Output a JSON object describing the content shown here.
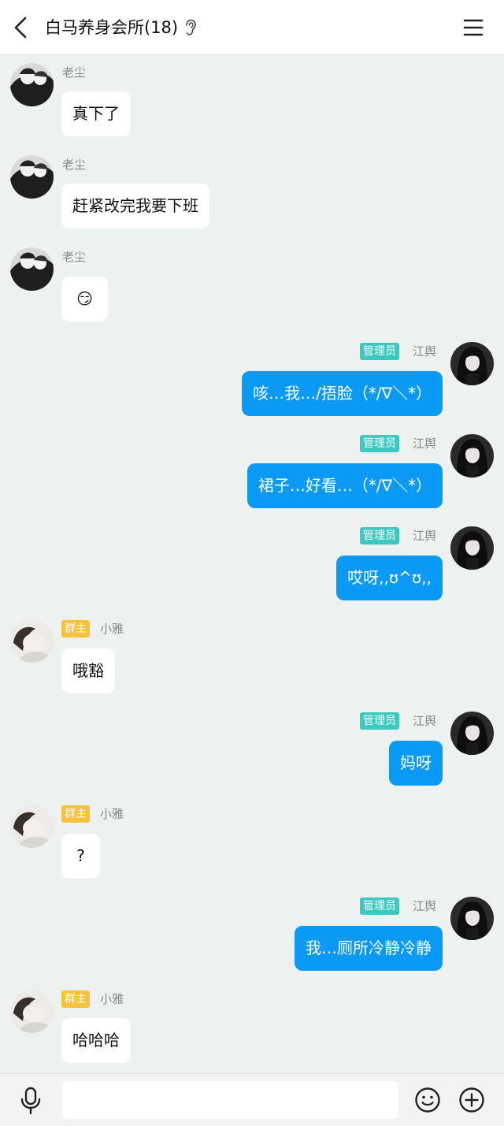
{
  "header": {
    "title": "白马养身会所(18)"
  },
  "messages": [
    {
      "side": "left",
      "name": "老尘",
      "text": "真下了",
      "avatar": "dark"
    },
    {
      "side": "left",
      "name": "老尘",
      "text": "赶紧改完我要下班",
      "avatar": "dark"
    },
    {
      "side": "left",
      "name": "老尘",
      "text": "😏",
      "avatar": "dark"
    },
    {
      "side": "right",
      "badge": "管理员",
      "name": "江舆",
      "text": "咳…我…/捂脸（*/∇＼*）",
      "avatar": "dark"
    },
    {
      "side": "right",
      "badge": "管理员",
      "name": "江舆",
      "text": "裙子…好看…（*/∇＼*）",
      "avatar": "dark"
    },
    {
      "side": "right",
      "badge": "管理员",
      "name": "江舆",
      "text": "哎呀,,ʊ^ʊ,,",
      "avatar": "dark"
    },
    {
      "side": "left",
      "badge": "群主",
      "name": "小雅",
      "text": "哦豁",
      "avatar": "light"
    },
    {
      "side": "right",
      "badge": "管理员",
      "name": "江舆",
      "text": "妈呀",
      "avatar": "dark"
    },
    {
      "side": "left",
      "badge": "群主",
      "name": "小雅",
      "text": "?",
      "avatar": "light"
    },
    {
      "side": "right",
      "badge": "管理员",
      "name": "江舆",
      "text": "我…厕所冷静冷静",
      "avatar": "dark"
    },
    {
      "side": "left",
      "badge": "群主",
      "name": "小雅",
      "text": "哈哈哈",
      "avatar": "light"
    }
  ],
  "input": {
    "placeholder": ""
  },
  "colors": {
    "self_bubble": "#0a99f5",
    "other_bubble": "#ffffff",
    "admin_badge": "#3cc9c2",
    "owner_badge": "#f7c23a",
    "background": "#edf1ef"
  },
  "icons": {
    "back": "chevron-left-icon",
    "ear": "ear-icon",
    "menu": "menu-icon",
    "mic": "mic-icon",
    "emoji": "smile-icon",
    "plus": "plus-circle-icon"
  }
}
